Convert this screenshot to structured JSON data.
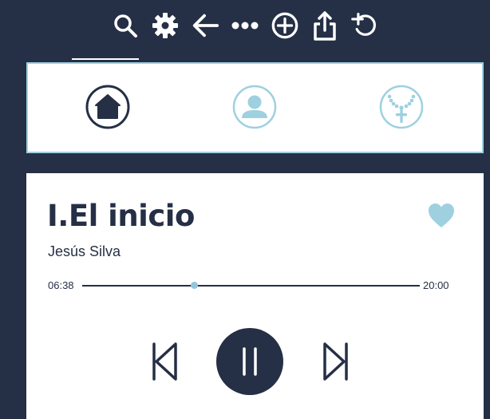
{
  "toolbar": {
    "icons": [
      "search-icon",
      "gear-icon",
      "arrow-left-icon",
      "more-icon",
      "plus-circle-icon",
      "share-icon",
      "undo-icon"
    ]
  },
  "nav": {
    "items": [
      {
        "name": "home",
        "icon": "home-icon",
        "active": true
      },
      {
        "name": "profile",
        "icon": "user-icon",
        "active": false
      },
      {
        "name": "rosary",
        "icon": "rosary-icon",
        "active": false
      }
    ]
  },
  "player": {
    "title": "I.El inicio",
    "artist": "Jesús Silva",
    "current_time": "06:38",
    "total_time": "20:00",
    "progress": 0.3317,
    "favorite": true,
    "state": "playing"
  },
  "colors": {
    "background": "#252f45",
    "accent": "#9ed0e0",
    "knob": "#8fc8da",
    "card": "#ffffff"
  }
}
